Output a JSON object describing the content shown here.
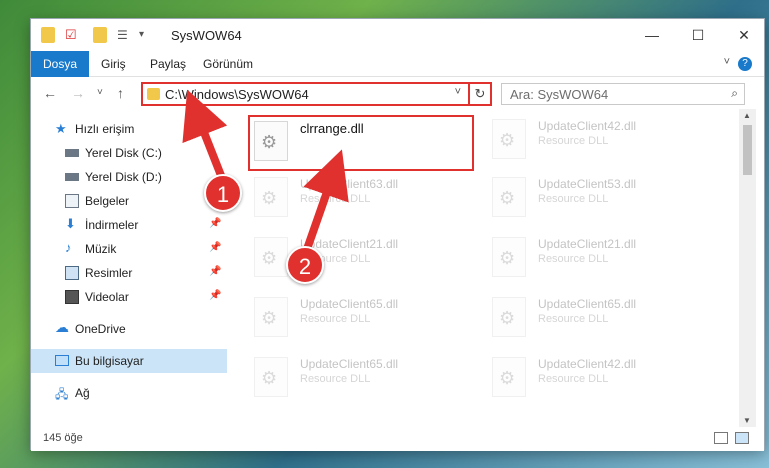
{
  "window": {
    "title": "SysWOW64",
    "minimize": "—",
    "maximize": "☐",
    "close": "✕"
  },
  "ribbon": {
    "tabs": [
      "Dosya",
      "Giriş",
      "Paylaş",
      "Görünüm"
    ],
    "active_tab": "Dosya",
    "help": "?",
    "expand": "˅"
  },
  "nav": {
    "back": "←",
    "forward": "→",
    "recent": "˅",
    "up": "↑",
    "address": "C:\\Windows\\SysWOW64",
    "address_dropdown": "˅",
    "refresh": "↻",
    "search_placeholder": "Ara: SysWOW64",
    "search_icon": "⌕"
  },
  "sidebar": {
    "items": [
      {
        "label": "Hızlı erişim",
        "icon": "star-icon"
      },
      {
        "label": "Yerel Disk (C:)",
        "icon": "drive-icon"
      },
      {
        "label": "Yerel Disk (D:)",
        "icon": "drive-icon"
      },
      {
        "label": "Belgeler",
        "icon": "documents-icon"
      },
      {
        "label": "İndirmeler",
        "icon": "download-icon",
        "pinned": true
      },
      {
        "label": "Müzik",
        "icon": "music-icon",
        "pinned": true
      },
      {
        "label": "Resimler",
        "icon": "pictures-icon",
        "pinned": true
      },
      {
        "label": "Videolar",
        "icon": "videos-icon",
        "pinned": true
      },
      {
        "label": "OneDrive",
        "icon": "cloud-icon"
      },
      {
        "label": "Bu bilgisayar",
        "icon": "computer-icon",
        "selected": true
      },
      {
        "label": "Ağ",
        "icon": "network-icon"
      }
    ],
    "pin_glyph": "📌"
  },
  "files": [
    {
      "name": "clrrange.dll",
      "type": "",
      "highlighted": true
    },
    {
      "name": "UpdateClient42.dll",
      "type": "Resource DLL"
    },
    {
      "name": "UpdateClient63.dll",
      "type": "Resource DLL"
    },
    {
      "name": "UpdateClient53.dll",
      "type": "Resource DLL"
    },
    {
      "name": "UpdateClient21.dll",
      "type": "Resource DLL"
    },
    {
      "name": "UpdateClient21.dll",
      "type": "Resource DLL"
    },
    {
      "name": "UpdateClient65.dll",
      "type": "Resource DLL"
    },
    {
      "name": "UpdateClient65.dll",
      "type": "Resource DLL"
    },
    {
      "name": "UpdateClient65.dll",
      "type": "Resource DLL"
    },
    {
      "name": "UpdateClient42.dll",
      "type": "Resource DLL"
    }
  ],
  "status": {
    "count": "145 öğe"
  },
  "callouts": [
    "1",
    "2"
  ],
  "colors": {
    "accent": "#1979ca",
    "highlight": "#e0312f",
    "folder": "#f2c84b",
    "selected": "#cce4f7"
  }
}
